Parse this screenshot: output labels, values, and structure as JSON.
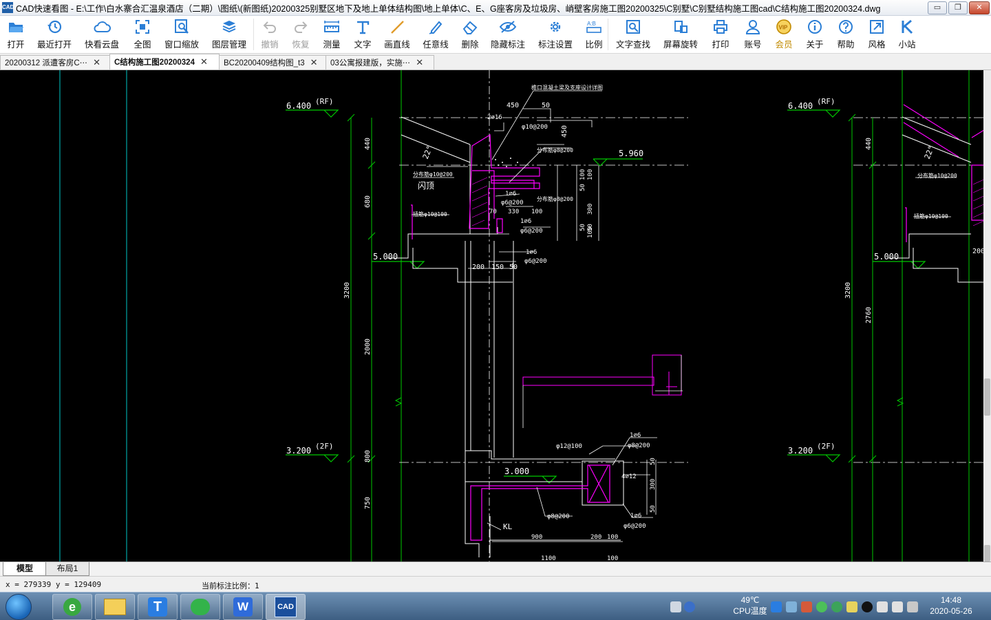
{
  "window": {
    "title": "CAD快速看图 - E:\\工作\\白水寨合汇温泉酒店（二期）\\图纸\\(新图纸)20200325别墅区地下及地上单体结构图\\地上单体\\C、E、G座客房及垃圾房、峭壁客房施工图20200325\\C别墅\\C别墅结构施工图cad\\C结构施工图20200324.dwg",
    "logo_text": "CAD",
    "minimize": "▭",
    "restore": "❐",
    "close": "✕"
  },
  "toolbar": {
    "open": "打开",
    "recent": "最近打开",
    "cloud": "快看云盘",
    "fit_all": "全图",
    "window_zoom": "窗口缩放",
    "layers": "图层管理",
    "undo": "撤销",
    "redo": "恢复",
    "measure": "测量",
    "text": "文字",
    "draw_line": "画直线",
    "freehand": "任意线",
    "erase": "删除",
    "hide_dims": "隐藏标注",
    "dim_settings": "标注设置",
    "scale": "比例",
    "find_text": "文字查找",
    "rotate": "屏幕旋转",
    "print": "打印",
    "account": "账号",
    "vip": "会员",
    "about": "关于",
    "help": "帮助",
    "style": "风格",
    "miniapp": "小站"
  },
  "doc_tabs": [
    {
      "label": "20200312 派遭客房C⋯"
    },
    {
      "label": "C结构施工图20200324"
    },
    {
      "label": "BC20200409结构图_t3"
    },
    {
      "label": "03公寓报建版，实施⋯"
    }
  ],
  "drawing": {
    "level_rf": "6.400",
    "rf": "(RF)",
    "level_2f": "3.200",
    "f2": "(2F)",
    "level_5000": "5.000",
    "level_5960": "5.960",
    "level_3000": "3.000",
    "dims_left": [
      "440",
      "680",
      "3200",
      "2000",
      "800",
      "750"
    ],
    "dims_right": [
      "440",
      "3200",
      "2760"
    ],
    "angle": "22°",
    "ridge_note": "檐口混凝土梁及支座设计详图",
    "bar_2a16": "2⌀16",
    "bar_10_200": "φ10@200",
    "bar_8_200": "φ8@200",
    "dim_450": "450",
    "dim_50": "50",
    "dim_450b": "450",
    "label_gutter": "闪顶",
    "note_10_200": "分布筋φ10@200",
    "note_8_200": "分布筋φ8@200",
    "note_10_100": "插筋φ10@100",
    "bar_1a6": "1⌀6",
    "bar_6_200": "φ6@200",
    "dim_330": "330",
    "dim_100": "100",
    "dim_70": "70",
    "dim_200": "200",
    "dim_150": "150",
    "dims_small_vert": [
      "50",
      "100",
      "100",
      "50",
      "300",
      "50",
      "100"
    ],
    "bar_12_100": "φ12@100",
    "bar_4a12": "4⌀12",
    "kl": "KL",
    "dim_900": "900",
    "dim_200b": "200",
    "dim_100b": "100",
    "dim_1100": "1100",
    "dim_100c": "100",
    "dims_beam_vert": [
      "50",
      "300",
      "50"
    ],
    "bar_8_200b": "φ8@200",
    "bar_6_200b": "φ6@200",
    "note_10_200r": "分布筋φ10@200",
    "note_10_100r": "插筋φ10@100",
    "dim_200r": "200"
  },
  "layout_tabs": {
    "model": "模型",
    "layout1": "布局1"
  },
  "status": {
    "coords": "x = 279339  y = 129409",
    "scale": "当前标注比例：1"
  },
  "taskbar": {
    "cpu_temp": "49℃",
    "cpu_label": "CPU温度",
    "time": "14:48",
    "date": "2020-05-26"
  }
}
